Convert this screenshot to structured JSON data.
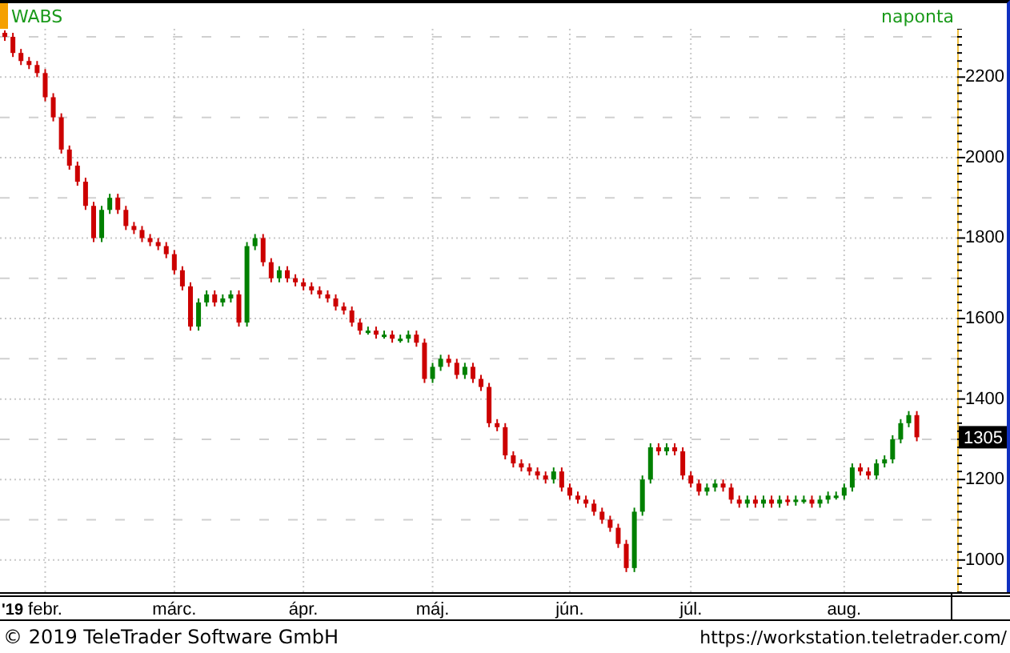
{
  "chart": {
    "symbol": "WABS",
    "interval": "naponta",
    "year_label": "'19",
    "last_price": "1305",
    "chart_data": {
      "type": "candlestick",
      "grid": true,
      "ylim": [
        920,
        2320
      ],
      "yticks": [
        1000,
        1200,
        1400,
        1600,
        1800,
        2000,
        2200
      ],
      "categories": [
        null,
        null,
        null,
        null,
        null,
        "febr.",
        null,
        null,
        null,
        null,
        null,
        null,
        null,
        null,
        null,
        null,
        null,
        null,
        null,
        null,
        null,
        "márc.",
        null,
        null,
        null,
        null,
        null,
        null,
        null,
        null,
        null,
        null,
        null,
        null,
        null,
        null,
        null,
        "ápr.",
        null,
        null,
        null,
        null,
        null,
        null,
        null,
        null,
        null,
        null,
        null,
        null,
        null,
        null,
        null,
        "máj.",
        null,
        null,
        null,
        null,
        null,
        null,
        null,
        null,
        null,
        null,
        null,
        null,
        null,
        null,
        null,
        null,
        "jún.",
        null,
        null,
        null,
        null,
        null,
        null,
        null,
        null,
        null,
        null,
        null,
        null,
        null,
        null,
        "júl.",
        null,
        null,
        null,
        null,
        null,
        null,
        null,
        null,
        null,
        null,
        null,
        null,
        null,
        null,
        null,
        null,
        null,
        null,
        "aug.",
        null,
        null,
        null,
        null,
        null,
        null,
        null,
        null,
        null
      ],
      "ohlc": [
        [
          2310,
          2316,
          2290,
          2300
        ],
        [
          2300,
          2310,
          2250,
          2260
        ],
        [
          2260,
          2270,
          2230,
          2240
        ],
        [
          2240,
          2250,
          2220,
          2230
        ],
        [
          2230,
          2240,
          2200,
          2210
        ],
        [
          2210,
          2220,
          2140,
          2150
        ],
        [
          2150,
          2160,
          2090,
          2100
        ],
        [
          2100,
          2110,
          2010,
          2020
        ],
        [
          2020,
          2030,
          1970,
          1980
        ],
        [
          1980,
          1990,
          1930,
          1940
        ],
        [
          1940,
          1950,
          1870,
          1880
        ],
        [
          1880,
          1890,
          1790,
          1800
        ],
        [
          1800,
          1880,
          1790,
          1870
        ],
        [
          1870,
          1910,
          1860,
          1900
        ],
        [
          1900,
          1910,
          1860,
          1870
        ],
        [
          1870,
          1880,
          1820,
          1830
        ],
        [
          1830,
          1840,
          1810,
          1820
        ],
        [
          1820,
          1830,
          1790,
          1800
        ],
        [
          1800,
          1810,
          1780,
          1790
        ],
        [
          1790,
          1800,
          1770,
          1780
        ],
        [
          1780,
          1790,
          1750,
          1760
        ],
        [
          1760,
          1770,
          1710,
          1720
        ],
        [
          1720,
          1730,
          1670,
          1680
        ],
        [
          1680,
          1690,
          1570,
          1580
        ],
        [
          1580,
          1650,
          1570,
          1640
        ],
        [
          1640,
          1670,
          1630,
          1660
        ],
        [
          1660,
          1670,
          1630,
          1640
        ],
        [
          1640,
          1660,
          1630,
          1650
        ],
        [
          1650,
          1670,
          1640,
          1660
        ],
        [
          1660,
          1670,
          1580,
          1590
        ],
        [
          1590,
          1790,
          1580,
          1780
        ],
        [
          1780,
          1810,
          1770,
          1800
        ],
        [
          1800,
          1810,
          1730,
          1740
        ],
        [
          1740,
          1750,
          1690,
          1700
        ],
        [
          1700,
          1730,
          1690,
          1720
        ],
        [
          1720,
          1730,
          1690,
          1700
        ],
        [
          1700,
          1710,
          1680,
          1690
        ],
        [
          1690,
          1700,
          1670,
          1680
        ],
        [
          1680,
          1690,
          1660,
          1670
        ],
        [
          1670,
          1680,
          1650,
          1660
        ],
        [
          1660,
          1670,
          1640,
          1650
        ],
        [
          1650,
          1660,
          1620,
          1630
        ],
        [
          1630,
          1640,
          1610,
          1620
        ],
        [
          1620,
          1630,
          1580,
          1590
        ],
        [
          1590,
          1600,
          1560,
          1570
        ],
        [
          1570,
          1580,
          1560,
          1570
        ],
        [
          1570,
          1580,
          1550,
          1560
        ],
        [
          1560,
          1570,
          1550,
          1560
        ],
        [
          1560,
          1570,
          1540,
          1550
        ],
        [
          1550,
          1560,
          1540,
          1550
        ],
        [
          1550,
          1570,
          1540,
          1560
        ],
        [
          1560,
          1570,
          1530,
          1540
        ],
        [
          1540,
          1550,
          1440,
          1450
        ],
        [
          1450,
          1490,
          1440,
          1480
        ],
        [
          1480,
          1510,
          1470,
          1500
        ],
        [
          1500,
          1510,
          1480,
          1490
        ],
        [
          1490,
          1500,
          1450,
          1460
        ],
        [
          1460,
          1490,
          1450,
          1480
        ],
        [
          1480,
          1490,
          1440,
          1450
        ],
        [
          1450,
          1460,
          1420,
          1430
        ],
        [
          1430,
          1440,
          1330,
          1340
        ],
        [
          1340,
          1350,
          1320,
          1330
        ],
        [
          1330,
          1340,
          1250,
          1260
        ],
        [
          1260,
          1270,
          1230,
          1240
        ],
        [
          1240,
          1250,
          1220,
          1230
        ],
        [
          1230,
          1240,
          1210,
          1220
        ],
        [
          1220,
          1230,
          1200,
          1210
        ],
        [
          1210,
          1220,
          1190,
          1200
        ],
        [
          1200,
          1230,
          1190,
          1220
        ],
        [
          1220,
          1230,
          1170,
          1180
        ],
        [
          1180,
          1190,
          1150,
          1160
        ],
        [
          1160,
          1170,
          1140,
          1150
        ],
        [
          1150,
          1160,
          1130,
          1140
        ],
        [
          1140,
          1150,
          1110,
          1120
        ],
        [
          1120,
          1130,
          1090,
          1100
        ],
        [
          1100,
          1110,
          1070,
          1080
        ],
        [
          1080,
          1090,
          1030,
          1040
        ],
        [
          1040,
          1050,
          970,
          980
        ],
        [
          980,
          1130,
          970,
          1120
        ],
        [
          1120,
          1210,
          1110,
          1200
        ],
        [
          1200,
          1290,
          1190,
          1280
        ],
        [
          1280,
          1290,
          1260,
          1270
        ],
        [
          1270,
          1290,
          1260,
          1280
        ],
        [
          1280,
          1290,
          1260,
          1270
        ],
        [
          1270,
          1280,
          1200,
          1210
        ],
        [
          1210,
          1220,
          1180,
          1190
        ],
        [
          1190,
          1200,
          1160,
          1170
        ],
        [
          1170,
          1190,
          1160,
          1180
        ],
        [
          1180,
          1200,
          1170,
          1190
        ],
        [
          1190,
          1200,
          1170,
          1180
        ],
        [
          1180,
          1190,
          1140,
          1150
        ],
        [
          1150,
          1160,
          1130,
          1140
        ],
        [
          1140,
          1160,
          1130,
          1150
        ],
        [
          1150,
          1160,
          1130,
          1140
        ],
        [
          1140,
          1160,
          1130,
          1150
        ],
        [
          1150,
          1160,
          1130,
          1140
        ],
        [
          1140,
          1160,
          1130,
          1150
        ],
        [
          1150,
          1160,
          1135,
          1145
        ],
        [
          1145,
          1160,
          1135,
          1150
        ],
        [
          1150,
          1160,
          1140,
          1150
        ],
        [
          1150,
          1160,
          1130,
          1140
        ],
        [
          1140,
          1160,
          1130,
          1150
        ],
        [
          1150,
          1170,
          1140,
          1160
        ],
        [
          1160,
          1170,
          1150,
          1160
        ],
        [
          1160,
          1190,
          1150,
          1180
        ],
        [
          1180,
          1240,
          1170,
          1230
        ],
        [
          1230,
          1240,
          1210,
          1220
        ],
        [
          1220,
          1230,
          1200,
          1210
        ],
        [
          1210,
          1250,
          1200,
          1240
        ],
        [
          1240,
          1260,
          1230,
          1250
        ],
        [
          1250,
          1310,
          1240,
          1300
        ],
        [
          1300,
          1350,
          1290,
          1340
        ],
        [
          1340,
          1370,
          1330,
          1360
        ],
        [
          1360,
          1370,
          1295,
          1305
        ]
      ]
    }
  },
  "footer": {
    "copyright": "© 2019 TeleTrader Software GmbH",
    "url": "https://workstation.teletrader.com/"
  }
}
